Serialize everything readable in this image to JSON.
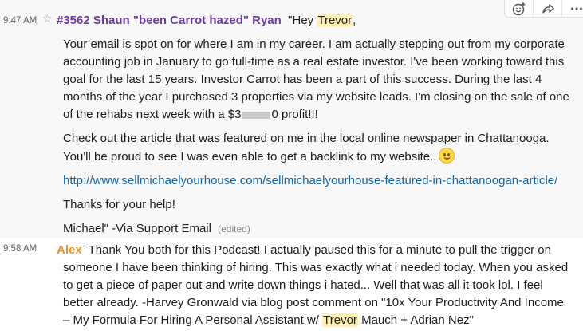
{
  "messages": [
    {
      "time": "9:47 AM",
      "sender": "#3562 Shaun \"been Carrot hazed\" Ryan",
      "greeting_pre": "\"Hey ",
      "greeting_name": "Trevor",
      "greeting_post": ",",
      "para1_a": "Your email is spot on for where I am in my career. I am actually stepping out from my corporate accounting job in January to go full-time as a real estate investor. I've been working toward this goal for the last 15 years. Investor Carrot has been a part of this success. During the last 4 months of the year I purchased 3 properties via my website leads. I'm closing on the sale of one of the rehabs next week with a $3",
      "para1_b": "0 profit!!!",
      "para2": "Check out the article that was featured on me in the local online newspaper in Chattanooga. You'll be proud to see I was even able to get a backlink to my website..",
      "link": "http://www.sellmichaelyourhouse.com/sellmichaelyourhouse-featured-in-chattanoogan-article/",
      "para3": "Thanks for your help!",
      "para4": "Michael\" -Via Support Email",
      "edited": "(edited)"
    },
    {
      "time": "9:58 AM",
      "sender": "Alex",
      "text_a": "Thank You both for this Podcast! I actually paused this for a minute to pull the trigger on someone I have been thinking of hiring. This was exactly what i needed today.  When you asked to get a piece of paper out and write down things i hated... Well that was all it took lol. I feel better already. -Harvey Gronwald via blog post comment on \"10x Your Productivity And Income – My Formula For Hiring A Personal Assistant w/ ",
      "text_name": "Trevor",
      "text_b": " Mauch + Adrian Nez\""
    }
  ],
  "colors": {
    "sender1": "#6f3b9e",
    "sender2": "#e8912d",
    "link": "#1264a3",
    "highlight": "#fff1b3"
  },
  "icons": [
    "star-icon",
    "add-reaction-icon",
    "share-icon",
    "more-actions-icon",
    "smiley-emoji-icon"
  ]
}
